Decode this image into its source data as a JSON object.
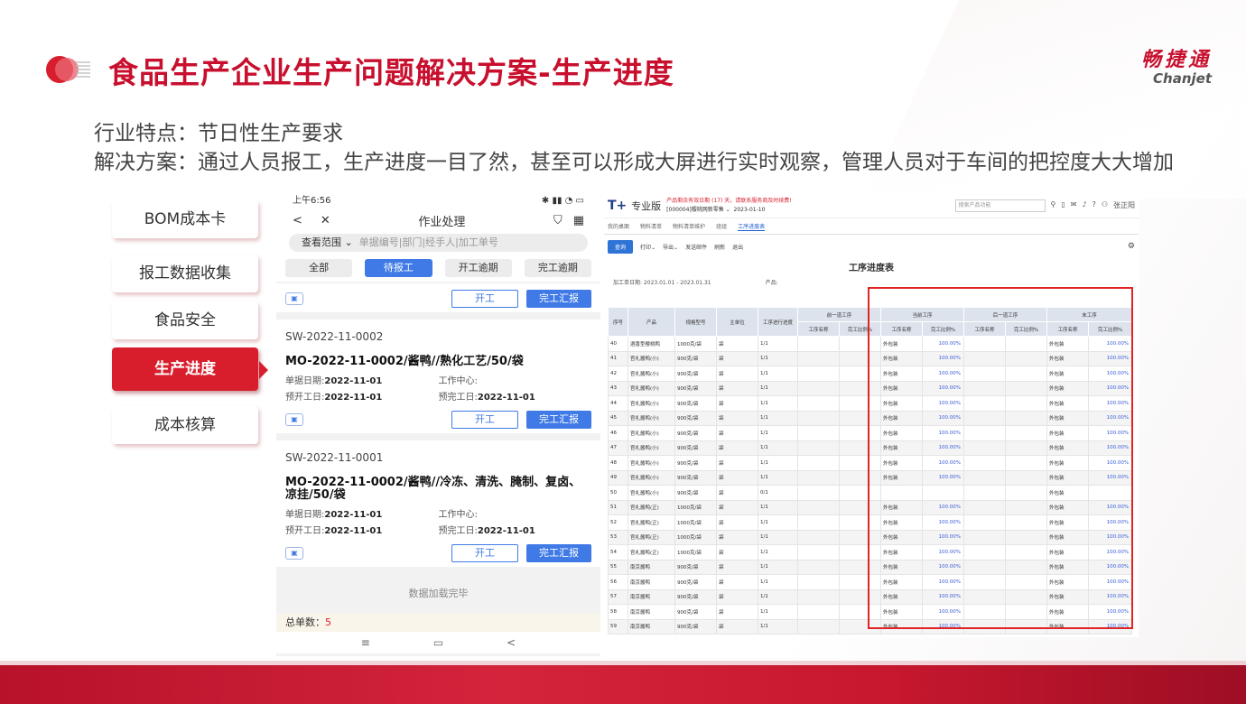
{
  "title": "食品生产企业生产问题解决方案-生产进度",
  "brand": {
    "cn": "畅捷通",
    "en": "Chanjet"
  },
  "desc": {
    "line1": "行业特点：节日性生产要求",
    "line2": "解决方案：通过人员报工，生产进度一目了然，甚至可以形成大屏进行实时观察，管理人员对于车间的把控度大大增加"
  },
  "menu": [
    {
      "label": "BOM成本卡",
      "active": false
    },
    {
      "label": "报工数据收集",
      "active": false
    },
    {
      "label": "食品安全",
      "active": false
    },
    {
      "label": "生产进度",
      "active": true
    },
    {
      "label": "成本核算",
      "active": false
    }
  ],
  "phone": {
    "time": "上午6:56",
    "status_right": "Sull Sull",
    "header_title": "作业处理",
    "scope_label": "查看范围 ⌄",
    "search_placeholder": "单据编号|部门|经手人|加工单号",
    "tabs": [
      "全部",
      "待报工",
      "开工逾期",
      "完工逾期"
    ],
    "start_btn": "开工",
    "report_btn": "完工汇报",
    "cards": [
      {
        "code": "SW-2022-11-0002",
        "mo": "MO-2022-11-0002/酱鸭//熟化工艺/50/袋",
        "date_label": "单据日期:",
        "date": "2022-11-01",
        "center_label": "工作中心:",
        "start_label": "预开工日:",
        "start": "2022-11-01",
        "end_label": "预完工日:",
        "end": "2022-11-01"
      },
      {
        "code": "SW-2022-11-0001",
        "mo": "MO-2022-11-0002/酱鸭//冷冻、清洗、腌制、复卤、凉挂/50/袋",
        "date_label": "单据日期:",
        "date": "2022-11-01",
        "center_label": "工作中心:",
        "start_label": "预开工日:",
        "start": "2022-11-01",
        "end_label": "预完工日:",
        "end": "2022-11-01"
      }
    ],
    "end_text": "数据加载完毕",
    "total_label": "总单数：",
    "total": "5"
  },
  "erp": {
    "logo": "T+",
    "edition": "专业版",
    "warning": "产品剩余有效日期 (17) 天，请联系服务商及时续费!",
    "company": "[000004]樱桃网新零售 ⌄",
    "date": "2023-01-10",
    "search_placeholder": "搜索产品功能",
    "user": "张正阳",
    "tabs": [
      "我的桌面",
      "物料清单",
      "物料清单维护",
      "班组",
      "工序进度表"
    ],
    "toolbar": [
      "查询",
      "打印⌄",
      "导出⌄",
      "发送邮件",
      "刷新",
      "退出"
    ],
    "report_title": "工序进度表",
    "date_filter": "加工单日期: 2023.01.01 - 2023.01.31",
    "product_filter": "产品:",
    "headers": [
      "序号",
      "产品",
      "规格型号",
      "主单位",
      "工序进行进度"
    ],
    "groups": [
      "前一道工序",
      "当前工序",
      "后一道工序",
      "末工序"
    ],
    "subheaders": [
      "工序名称",
      "完工比例%"
    ],
    "rows": [
      {
        "no": "40",
        "prod": "酒香型樱桃鸭",
        "spec": "1000克/袋",
        "prog": "1/1",
        "cur": "外包装",
        "p1": "100.00%",
        "last": "外包装",
        "p2": "100.00%"
      },
      {
        "no": "41",
        "prod": "官礼酱鸭(小)",
        "spec": "900克/袋",
        "prog": "1/1",
        "cur": "外包装",
        "p1": "100.00%",
        "last": "外包装",
        "p2": "100.00%"
      },
      {
        "no": "42",
        "prod": "官礼酱鸭(小)",
        "spec": "900克/袋",
        "prog": "1/1",
        "cur": "外包装",
        "p1": "100.00%",
        "last": "外包装",
        "p2": "100.00%"
      },
      {
        "no": "43",
        "prod": "官礼酱鸭(小)",
        "spec": "900克/袋",
        "prog": "1/1",
        "cur": "外包装",
        "p1": "100.00%",
        "last": "外包装",
        "p2": "100.00%"
      },
      {
        "no": "44",
        "prod": "官礼酱鸭(小)",
        "spec": "900克/袋",
        "prog": "1/1",
        "cur": "外包装",
        "p1": "100.00%",
        "last": "外包装",
        "p2": "100.00%"
      },
      {
        "no": "45",
        "prod": "官礼酱鸭(小)",
        "spec": "900克/袋",
        "prog": "1/1",
        "cur": "外包装",
        "p1": "100.00%",
        "last": "外包装",
        "p2": "100.00%"
      },
      {
        "no": "46",
        "prod": "官礼酱鸭(小)",
        "spec": "900克/袋",
        "prog": "1/1",
        "cur": "外包装",
        "p1": "100.00%",
        "last": "外包装",
        "p2": "100.00%"
      },
      {
        "no": "47",
        "prod": "官礼酱鸭(小)",
        "spec": "900克/袋",
        "prog": "1/1",
        "cur": "外包装",
        "p1": "100.00%",
        "last": "外包装",
        "p2": "100.00%"
      },
      {
        "no": "48",
        "prod": "官礼酱鸭(小)",
        "spec": "900克/袋",
        "prog": "1/1",
        "cur": "外包装",
        "p1": "100.00%",
        "last": "外包装",
        "p2": "100.00%"
      },
      {
        "no": "49",
        "prod": "官礼酱鸭(小)",
        "spec": "900克/袋",
        "prog": "1/1",
        "cur": "外包装",
        "p1": "100.00%",
        "last": "外包装",
        "p2": "100.00%"
      },
      {
        "no": "50",
        "prod": "官礼酱鸭(小)",
        "spec": "900克/袋",
        "prog": "0/1",
        "cur": "",
        "p1": "",
        "last": "外包装",
        "p2": ""
      },
      {
        "no": "51",
        "prod": "官礼酱鸭(正)",
        "spec": "1000克/袋",
        "prog": "1/1",
        "cur": "外包装",
        "p1": "100.00%",
        "last": "外包装",
        "p2": "100.00%"
      },
      {
        "no": "52",
        "prod": "官礼酱鸭(正)",
        "spec": "1000克/袋",
        "prog": "1/1",
        "cur": "外包装",
        "p1": "100.00%",
        "last": "外包装",
        "p2": "100.00%"
      },
      {
        "no": "53",
        "prod": "官礼酱鸭(正)",
        "spec": "1000克/袋",
        "prog": "1/1",
        "cur": "外包装",
        "p1": "100.00%",
        "last": "外包装",
        "p2": "100.00%"
      },
      {
        "no": "54",
        "prod": "官礼酱鸭(正)",
        "spec": "1000克/袋",
        "prog": "1/1",
        "cur": "外包装",
        "p1": "100.00%",
        "last": "外包装",
        "p2": "100.00%"
      },
      {
        "no": "55",
        "prod": "南京酱鸭",
        "spec": "900克/袋",
        "prog": "1/1",
        "cur": "外包装",
        "p1": "100.00%",
        "last": "外包装",
        "p2": "100.00%"
      },
      {
        "no": "56",
        "prod": "南京酱鸭",
        "spec": "900克/袋",
        "prog": "1/1",
        "cur": "外包装",
        "p1": "100.00%",
        "last": "外包装",
        "p2": "100.00%"
      },
      {
        "no": "57",
        "prod": "南京酱鸭",
        "spec": "900克/袋",
        "prog": "1/1",
        "cur": "外包装",
        "p1": "100.00%",
        "last": "外包装",
        "p2": "100.00%"
      },
      {
        "no": "58",
        "prod": "南京酱鸭",
        "spec": "900克/袋",
        "prog": "1/1",
        "cur": "外包装",
        "p1": "100.00%",
        "last": "外包装",
        "p2": "100.00%"
      },
      {
        "no": "59",
        "prod": "南京酱鸭",
        "spec": "900克/袋",
        "prog": "1/1",
        "cur": "外包装",
        "p1": "100.00%",
        "last": "外包装",
        "p2": "100.00%"
      }
    ],
    "unit": "袋"
  },
  "colors": {
    "accent": "#c8102e",
    "active_menu": "#d81e2c",
    "mobile_blue": "#3f7ae6",
    "highlight_box": "#e02424"
  }
}
